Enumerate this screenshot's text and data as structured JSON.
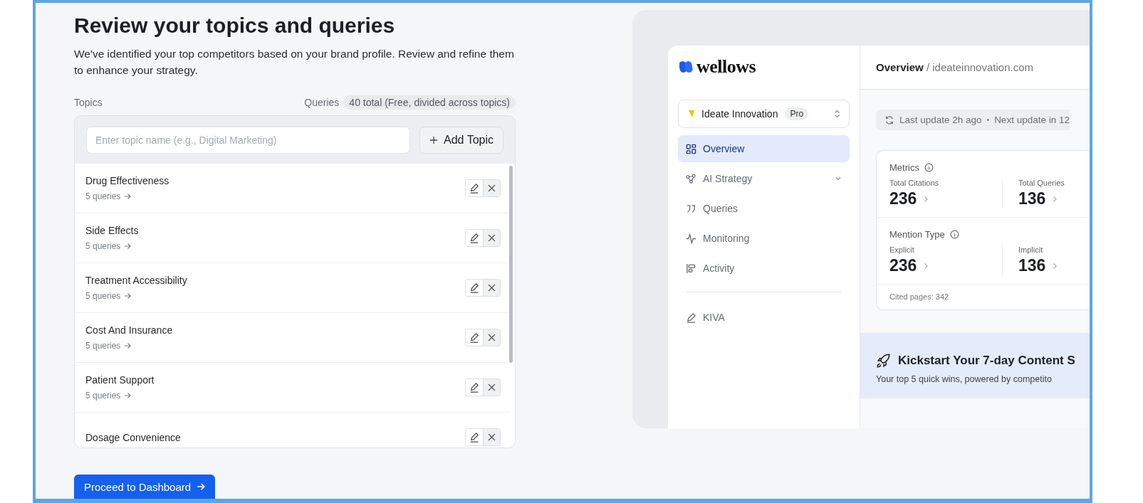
{
  "page": {
    "title": "Review your topics and queries",
    "description": "We've identified your top competitors based on your brand profile. Review and refine them to enhance your strategy."
  },
  "topics_header": {
    "label": "Topics",
    "queries_label": "Queries",
    "queries_badge": "40 total (Free, divided across topics)"
  },
  "topic_input": {
    "placeholder": "Enter topic name (e.g., Digital Marketing)"
  },
  "add_topic_button": {
    "label": "Add Topic"
  },
  "topics": [
    {
      "name": "Drug Effectiveness",
      "queries": "5 queries"
    },
    {
      "name": "Side Effects",
      "queries": "5 queries"
    },
    {
      "name": "Treatment Accessibility",
      "queries": "5 queries"
    },
    {
      "name": "Cost And Insurance",
      "queries": "5 queries"
    },
    {
      "name": "Patient Support",
      "queries": "5 queries"
    },
    {
      "name": "Dosage Convenience"
    }
  ],
  "proceed_button": {
    "label": "Proceed to Dashboard"
  },
  "preview": {
    "logo": "wellows",
    "workspace": {
      "name": "Ideate Innovation",
      "plan": "Pro"
    },
    "nav": [
      {
        "label": "Overview",
        "selected": true,
        "expandable": false
      },
      {
        "label": "AI Strategy",
        "selected": false,
        "expandable": true
      },
      {
        "label": "Queries",
        "selected": false,
        "expandable": false
      },
      {
        "label": "Monitoring",
        "selected": false,
        "expandable": false
      },
      {
        "label": "Activity",
        "selected": false,
        "expandable": false
      }
    ],
    "nav_footer": [
      {
        "label": "KIVA",
        "selected": false,
        "expandable": false
      }
    ],
    "breadcrumb": {
      "current": "Overview",
      "separator": "/",
      "path": "ideateinnovation.com"
    },
    "update": {
      "last": "Last update 2h ago",
      "separator": "•",
      "next": "Next update in 12"
    },
    "metric_groups": [
      {
        "title": "Metrics",
        "items": [
          {
            "label": "Total Citations",
            "value": "236"
          },
          {
            "label": "Total Queries",
            "value": "136"
          }
        ]
      },
      {
        "title": "Mention Type",
        "items": [
          {
            "label": "Explicit",
            "value": "236"
          },
          {
            "label": "Implicit",
            "value": "136"
          }
        ]
      }
    ],
    "cited_pages": "Cited pages: 342",
    "banner": {
      "title": "Kickstart Your 7-day Content S",
      "subtitle": "Your top 5 quick wins, powered by competito"
    }
  }
}
